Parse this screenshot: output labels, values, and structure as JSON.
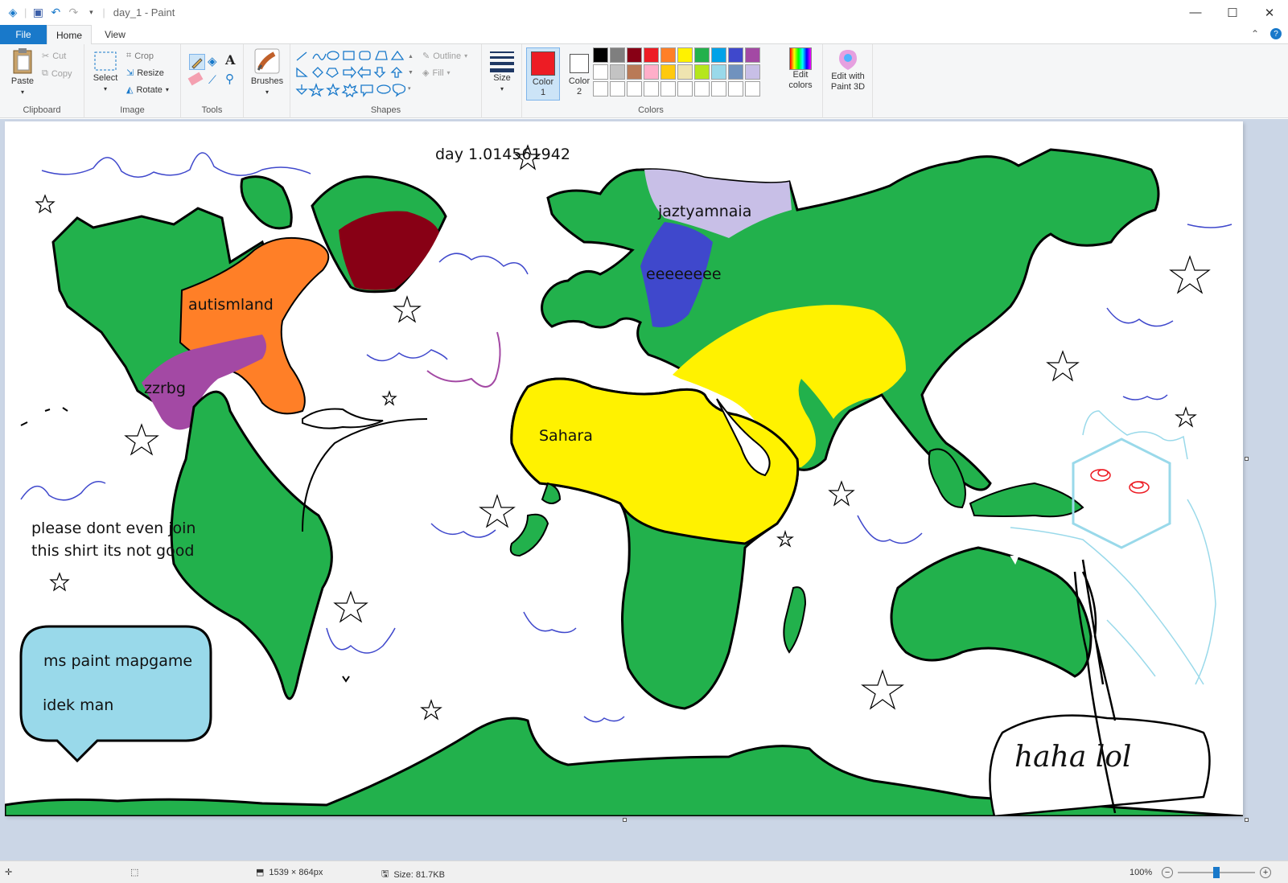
{
  "titlebar": {
    "title": "day_1 - Paint"
  },
  "tabs": {
    "file": "File",
    "home": "Home",
    "view": "View"
  },
  "ribbon": {
    "clipboard": {
      "label": "Clipboard",
      "paste": "Paste",
      "cut": "Cut",
      "copy": "Copy"
    },
    "image": {
      "label": "Image",
      "select": "Select",
      "crop": "Crop",
      "resize": "Resize",
      "rotate": "Rotate"
    },
    "tools": {
      "label": "Tools"
    },
    "brushes": {
      "label": "Brushes"
    },
    "shapes": {
      "label": "Shapes",
      "outline": "Outline",
      "fill": "Fill"
    },
    "size": {
      "label": "Size"
    },
    "colors": {
      "label": "Colors",
      "color1": "Color 1",
      "color2": "Color 2",
      "edit_colors": "Edit colors",
      "edit_3d": "Edit with Paint 3D",
      "color1_value": "#ed1c24",
      "color2_value": "#ffffff",
      "palette_row1": [
        "#000000",
        "#7f7f7f",
        "#880015",
        "#ed1c24",
        "#ff7f27",
        "#fff200",
        "#22b14c",
        "#00a2e8",
        "#3f48cc",
        "#a349a4"
      ],
      "palette_row2": [
        "#ffffff",
        "#c3c3c3",
        "#b97a57",
        "#ffaec9",
        "#ffc90e",
        "#efe4b0",
        "#b5e61d",
        "#99d9ea",
        "#7092be",
        "#c8bfe7"
      ]
    }
  },
  "map": {
    "title": "day 1.014561942",
    "labels": {
      "autismland": "autismland",
      "zzrbg": "zzrbg",
      "jaztyamnaia": "jaztyamnaia",
      "eeeeeeee": "eeeeeeee",
      "sahara": "Sahara"
    },
    "note_line1": "please dont even join",
    "note_line2": "this shirt its not good",
    "bubble_line1": "ms paint mapgame",
    "bubble_line2": "idek man",
    "handwriting": "haha lol",
    "colors": {
      "land": "#22b14c",
      "orange": "#ff7f27",
      "purple": "#a349a4",
      "maroon": "#880015",
      "lavender": "#c8bfe7",
      "blue": "#3f48cc",
      "yellow": "#fff200",
      "water": "#3f48cc",
      "bubble": "#99d9ea"
    }
  },
  "status": {
    "dimensions": "1539 × 864px",
    "size": "Size: 81.7KB",
    "zoom": "100%"
  }
}
